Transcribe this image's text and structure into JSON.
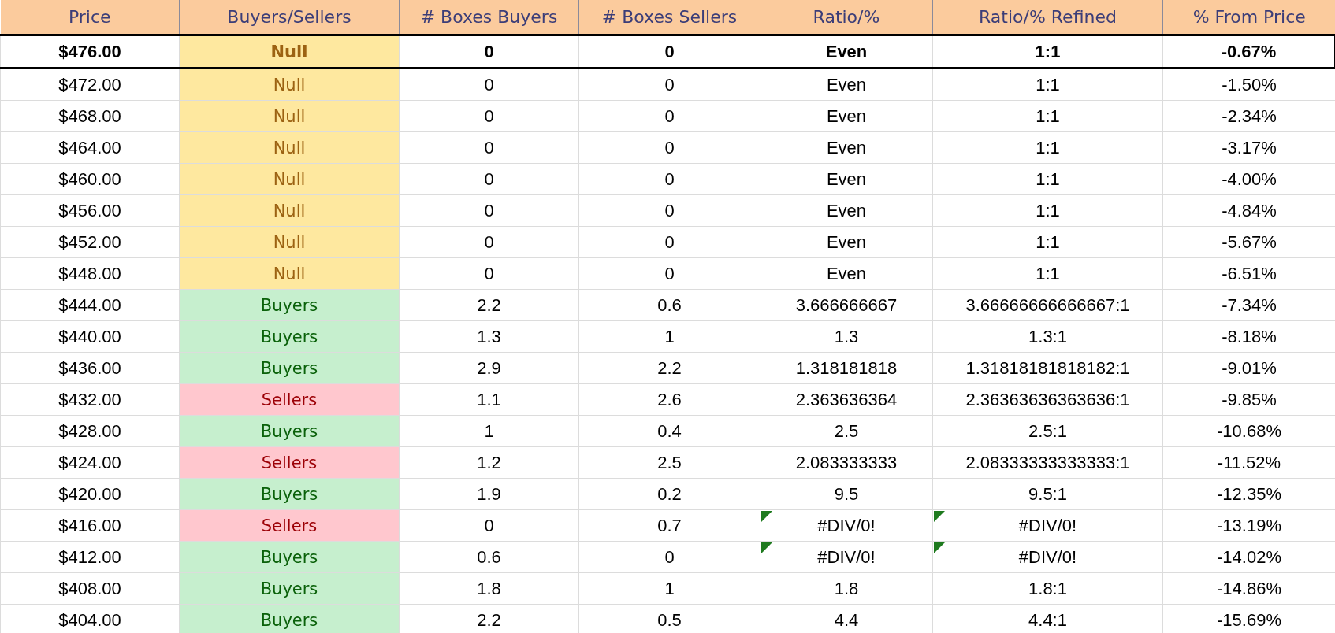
{
  "columns": [
    "Price",
    "Buyers/Sellers",
    "# Boxes Buyers",
    "# Boxes Sellers",
    "Ratio/%",
    "Ratio/% Refined",
    "% From Price"
  ],
  "rows": [
    {
      "price": "$476.00",
      "side": "Null",
      "kind": "null",
      "buyers": "0",
      "sellers": "0",
      "ratio": "Even",
      "refined": "1:1",
      "pct": "-0.67%",
      "current": true,
      "error_flag": false
    },
    {
      "price": "$472.00",
      "side": "Null",
      "kind": "null",
      "buyers": "0",
      "sellers": "0",
      "ratio": "Even",
      "refined": "1:1",
      "pct": "-1.50%",
      "current": false,
      "error_flag": false
    },
    {
      "price": "$468.00",
      "side": "Null",
      "kind": "null",
      "buyers": "0",
      "sellers": "0",
      "ratio": "Even",
      "refined": "1:1",
      "pct": "-2.34%",
      "current": false,
      "error_flag": false
    },
    {
      "price": "$464.00",
      "side": "Null",
      "kind": "null",
      "buyers": "0",
      "sellers": "0",
      "ratio": "Even",
      "refined": "1:1",
      "pct": "-3.17%",
      "current": false,
      "error_flag": false
    },
    {
      "price": "$460.00",
      "side": "Null",
      "kind": "null",
      "buyers": "0",
      "sellers": "0",
      "ratio": "Even",
      "refined": "1:1",
      "pct": "-4.00%",
      "current": false,
      "error_flag": false
    },
    {
      "price": "$456.00",
      "side": "Null",
      "kind": "null",
      "buyers": "0",
      "sellers": "0",
      "ratio": "Even",
      "refined": "1:1",
      "pct": "-4.84%",
      "current": false,
      "error_flag": false
    },
    {
      "price": "$452.00",
      "side": "Null",
      "kind": "null",
      "buyers": "0",
      "sellers": "0",
      "ratio": "Even",
      "refined": "1:1",
      "pct": "-5.67%",
      "current": false,
      "error_flag": false
    },
    {
      "price": "$448.00",
      "side": "Null",
      "kind": "null",
      "buyers": "0",
      "sellers": "0",
      "ratio": "Even",
      "refined": "1:1",
      "pct": "-6.51%",
      "current": false,
      "error_flag": false
    },
    {
      "price": "$444.00",
      "side": "Buyers",
      "kind": "buyers",
      "buyers": "2.2",
      "sellers": "0.6",
      "ratio": "3.666666667",
      "refined": "3.66666666666667:1",
      "pct": "-7.34%",
      "current": false,
      "error_flag": false
    },
    {
      "price": "$440.00",
      "side": "Buyers",
      "kind": "buyers",
      "buyers": "1.3",
      "sellers": "1",
      "ratio": "1.3",
      "refined": "1.3:1",
      "pct": "-8.18%",
      "current": false,
      "error_flag": false
    },
    {
      "price": "$436.00",
      "side": "Buyers",
      "kind": "buyers",
      "buyers": "2.9",
      "sellers": "2.2",
      "ratio": "1.318181818",
      "refined": "1.31818181818182:1",
      "pct": "-9.01%",
      "current": false,
      "error_flag": false
    },
    {
      "price": "$432.00",
      "side": "Sellers",
      "kind": "sellers",
      "buyers": "1.1",
      "sellers": "2.6",
      "ratio": "2.363636364",
      "refined": "2.36363636363636:1",
      "pct": "-9.85%",
      "current": false,
      "error_flag": false
    },
    {
      "price": "$428.00",
      "side": "Buyers",
      "kind": "buyers",
      "buyers": "1",
      "sellers": "0.4",
      "ratio": "2.5",
      "refined": "2.5:1",
      "pct": "-10.68%",
      "current": false,
      "error_flag": false
    },
    {
      "price": "$424.00",
      "side": "Sellers",
      "kind": "sellers",
      "buyers": "1.2",
      "sellers": "2.5",
      "ratio": "2.083333333",
      "refined": "2.08333333333333:1",
      "pct": "-11.52%",
      "current": false,
      "error_flag": false
    },
    {
      "price": "$420.00",
      "side": "Buyers",
      "kind": "buyers",
      "buyers": "1.9",
      "sellers": "0.2",
      "ratio": "9.5",
      "refined": "9.5:1",
      "pct": "-12.35%",
      "current": false,
      "error_flag": false
    },
    {
      "price": "$416.00",
      "side": "Sellers",
      "kind": "sellers",
      "buyers": "0",
      "sellers": "0.7",
      "ratio": "#DIV/0!",
      "refined": "#DIV/0!",
      "pct": "-13.19%",
      "current": false,
      "error_flag": true
    },
    {
      "price": "$412.00",
      "side": "Buyers",
      "kind": "buyers",
      "buyers": "0.6",
      "sellers": "0",
      "ratio": "#DIV/0!",
      "refined": "#DIV/0!",
      "pct": "-14.02%",
      "current": false,
      "error_flag": true
    },
    {
      "price": "$408.00",
      "side": "Buyers",
      "kind": "buyers",
      "buyers": "1.8",
      "sellers": "1",
      "ratio": "1.8",
      "refined": "1.8:1",
      "pct": "-14.86%",
      "current": false,
      "error_flag": false
    },
    {
      "price": "$404.00",
      "side": "Buyers",
      "kind": "buyers",
      "buyers": "2.2",
      "sellers": "0.5",
      "ratio": "4.4",
      "refined": "4.4:1",
      "pct": "-15.69%",
      "current": false,
      "error_flag": false
    }
  ]
}
